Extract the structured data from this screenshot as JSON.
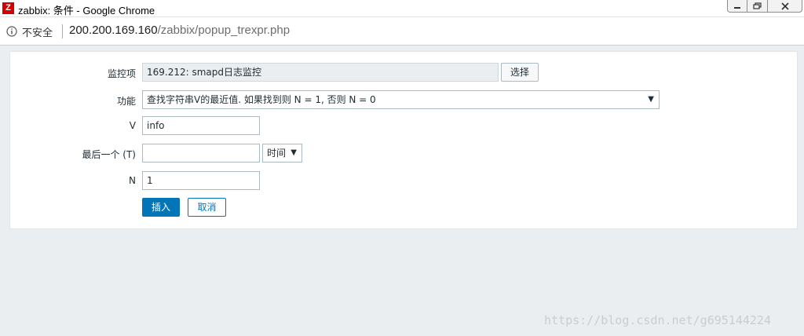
{
  "window": {
    "title": "zabbix: 条件 - Google Chrome",
    "app_icon_letter": "Z"
  },
  "address_bar": {
    "security_label": "不安全",
    "url_host": "200.200.169.160",
    "url_path": "/zabbix/popup_trexpr.php"
  },
  "form": {
    "item": {
      "label": "监控项",
      "value": "169.212: smapd日志监控",
      "select_button": "选择"
    },
    "function": {
      "label": "功能",
      "selected": "查找字符串V的最近值. 如果找到则 N = 1, 否则 N = 0"
    },
    "v": {
      "label": "V",
      "value": "info"
    },
    "last_t": {
      "label": "最后一个 (T)",
      "value": "",
      "unit_selected": "时间"
    },
    "n": {
      "label": "N",
      "value": "1"
    },
    "insert_button": "插入",
    "cancel_button": "取消"
  },
  "watermark": "https://blog.csdn.net/g695144224",
  "colors": {
    "primary": "#0275b8",
    "page_background": "#ebeef0",
    "readonly_field": "#ebeef0",
    "app_icon": "#d40000"
  }
}
